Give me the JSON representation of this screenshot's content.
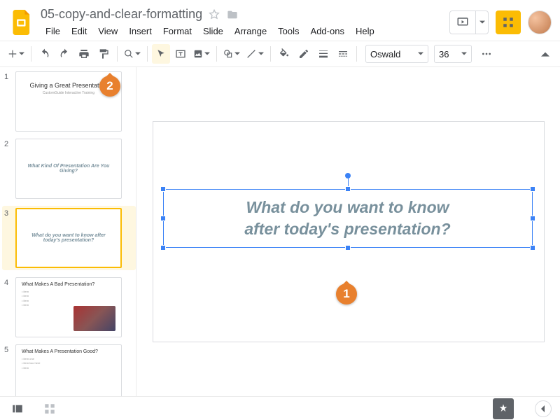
{
  "doc": {
    "title": "05-copy-and-clear-formatting"
  },
  "menus": [
    "File",
    "Edit",
    "View",
    "Insert",
    "Format",
    "Slide",
    "Arrange",
    "Tools",
    "Add-ons",
    "Help"
  ],
  "toolbar": {
    "font": "Oswald",
    "fontSize": "36"
  },
  "slides": [
    {
      "num": "1",
      "title": "Giving a Great Presentation",
      "subtitle": "CustomGuide Interactive Training"
    },
    {
      "num": "2",
      "center": "What Kind Of Presentation Are You Giving?"
    },
    {
      "num": "3",
      "center": "What do you want to know after today's presentation?",
      "selected": true
    },
    {
      "num": "4",
      "title": "What Makes A Bad Presentation?"
    },
    {
      "num": "5",
      "title": "What Makes A Presentation Good?"
    }
  ],
  "canvas": {
    "textLine1": "What do you want to know",
    "textLine2": "after today's presentation?"
  },
  "callouts": {
    "one": "1",
    "two": "2"
  }
}
